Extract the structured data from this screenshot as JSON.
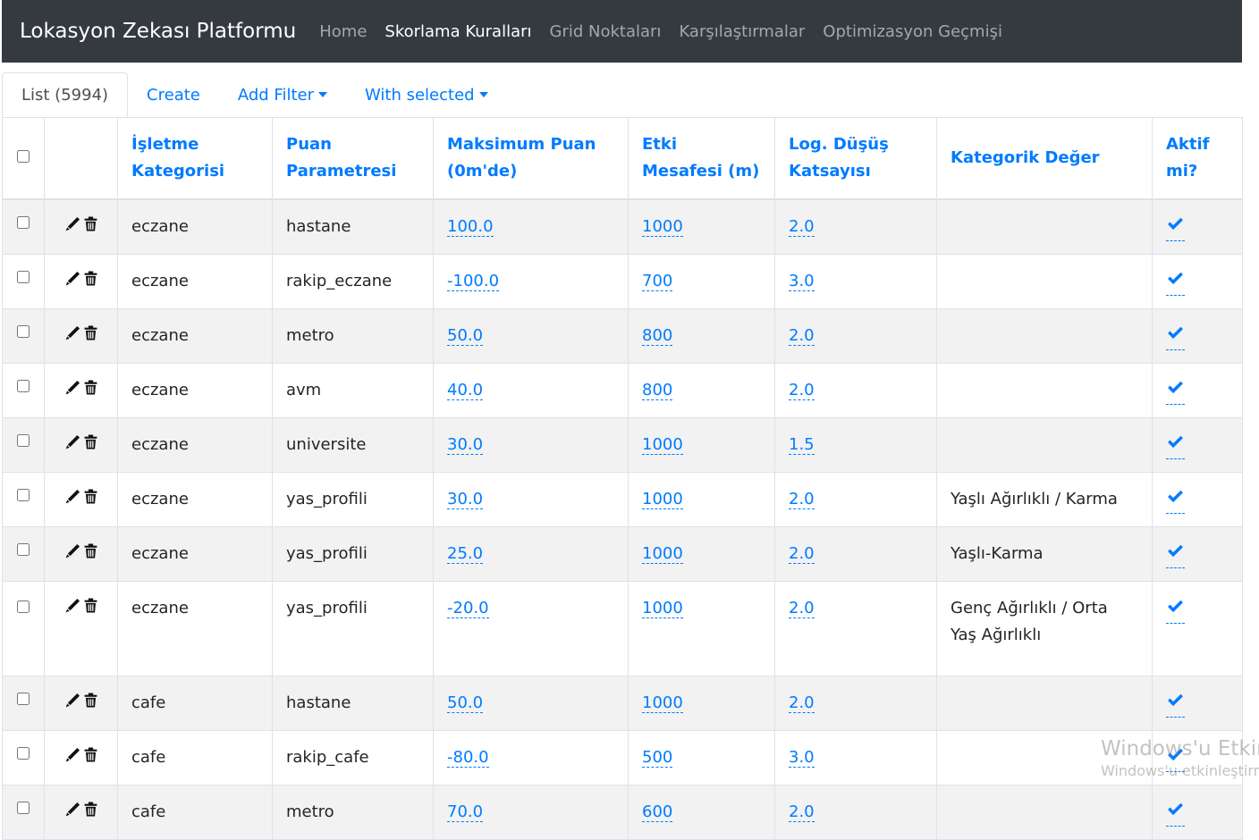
{
  "navbar": {
    "brand": "Lokasyon Zekası Platformu",
    "links": [
      {
        "label": "Home",
        "active": false
      },
      {
        "label": "Skorlama Kuralları",
        "active": true
      },
      {
        "label": "Grid Noktaları",
        "active": false
      },
      {
        "label": "Karşılaştırmalar",
        "active": false
      },
      {
        "label": "Optimizasyon Geçmişi",
        "active": false
      }
    ]
  },
  "tabs": {
    "list": "List (5994)",
    "create": "Create",
    "add_filter": "Add Filter",
    "with_selected": "With selected"
  },
  "table": {
    "headers": {
      "category": "İşletme Kategorisi",
      "parameter": "Puan Parametresi",
      "max_score": "Maksimum Puan (0m'de)",
      "distance": "Etki Mesafesi (m)",
      "log_decay": "Log. Düşüş Katsayısı",
      "categorical": "Kategorik Değer",
      "active": "Aktif mi?"
    },
    "rows": [
      {
        "category": "eczane",
        "parameter": "hastane",
        "max_score": "100.0",
        "distance": "1000",
        "log_decay": "2.0",
        "categorical": "",
        "active": true
      },
      {
        "category": "eczane",
        "parameter": "rakip_eczane",
        "max_score": "-100.0",
        "distance": "700",
        "log_decay": "3.0",
        "categorical": "",
        "active": true
      },
      {
        "category": "eczane",
        "parameter": "metro",
        "max_score": "50.0",
        "distance": "800",
        "log_decay": "2.0",
        "categorical": "",
        "active": true
      },
      {
        "category": "eczane",
        "parameter": "avm",
        "max_score": "40.0",
        "distance": "800",
        "log_decay": "2.0",
        "categorical": "",
        "active": true
      },
      {
        "category": "eczane",
        "parameter": "universite",
        "max_score": "30.0",
        "distance": "1000",
        "log_decay": "1.5",
        "categorical": "",
        "active": true
      },
      {
        "category": "eczane",
        "parameter": "yas_profili",
        "max_score": "30.0",
        "distance": "1000",
        "log_decay": "2.0",
        "categorical": "Yaşlı Ağırlıklı / Karma",
        "active": true
      },
      {
        "category": "eczane",
        "parameter": "yas_profili",
        "max_score": "25.0",
        "distance": "1000",
        "log_decay": "2.0",
        "categorical": "Yaşlı-Karma",
        "active": true
      },
      {
        "category": "eczane",
        "parameter": "yas_profili",
        "max_score": "-20.0",
        "distance": "1000",
        "log_decay": "2.0",
        "categorical": "Genç Ağırlıklı / Orta Yaş Ağırlıklı",
        "active": true
      },
      {
        "category": "cafe",
        "parameter": "hastane",
        "max_score": "50.0",
        "distance": "1000",
        "log_decay": "2.0",
        "categorical": "",
        "active": true
      },
      {
        "category": "cafe",
        "parameter": "rakip_cafe",
        "max_score": "-80.0",
        "distance": "500",
        "log_decay": "3.0",
        "categorical": "",
        "active": true
      },
      {
        "category": "cafe",
        "parameter": "metro",
        "max_score": "70.0",
        "distance": "600",
        "log_decay": "2.0",
        "categorical": "",
        "active": true
      }
    ]
  },
  "watermark": {
    "line1": "Windows'u Etkin",
    "line2": "Windows'u etkinleştirm"
  },
  "colors": {
    "navbar_bg": "#343a40",
    "link": "#007bff",
    "stripe": "#f2f2f2"
  },
  "icons": {
    "edit": "pencil-icon",
    "delete": "trash-icon",
    "active": "check-icon",
    "dropdown": "caret-down-icon"
  }
}
